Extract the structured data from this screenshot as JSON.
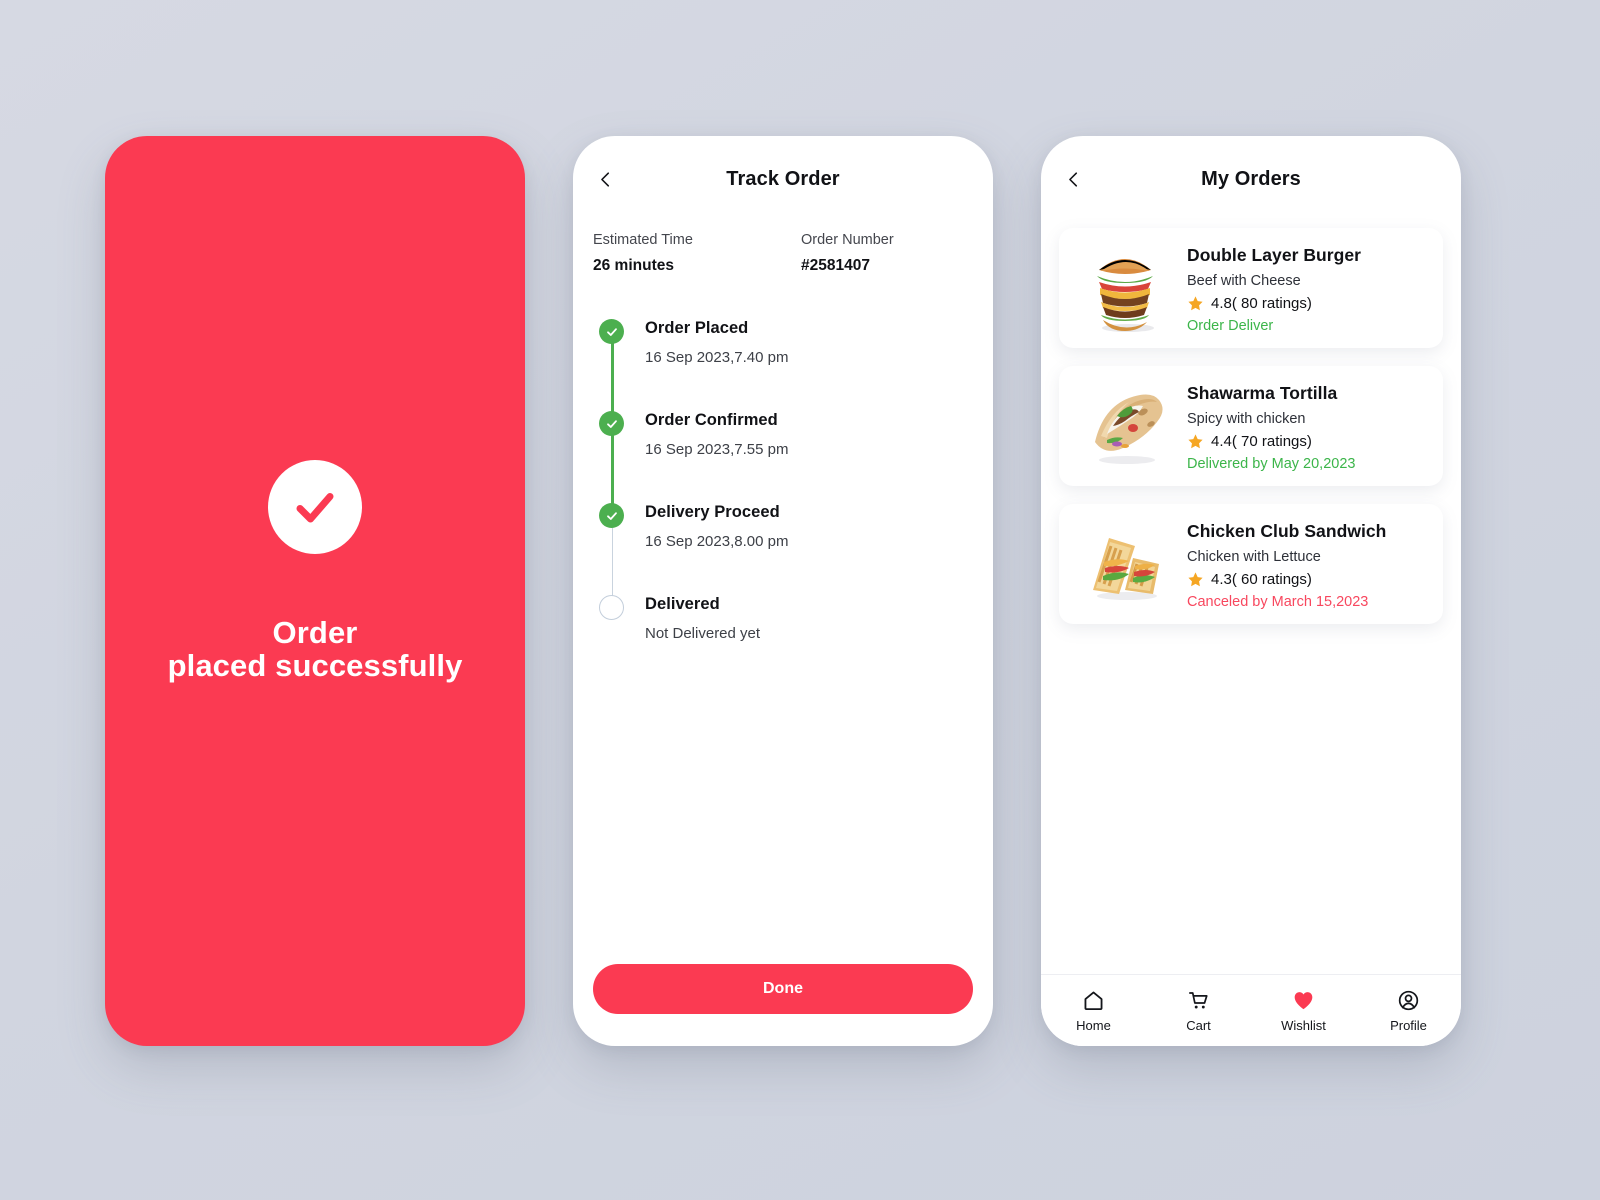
{
  "theme": {
    "brand_red": "#FB3A52",
    "status_green": "#3CB54A",
    "node_green": "#4CAF4F",
    "star_orange": "#F5A623",
    "page_background": "#D3D7E1"
  },
  "success_screen": {
    "icon": "check-circle-icon",
    "title_line1": "Order",
    "title_line2": "placed successfully"
  },
  "track_screen": {
    "back_icon": "chevron-left-icon",
    "title": "Track Order",
    "meta": {
      "estimated_time_label": "Estimated Time",
      "estimated_time_value": "26 minutes",
      "order_number_label": "Order Number",
      "order_number_value": "#2581407"
    },
    "steps": [
      {
        "title": "Order Placed",
        "time": "16 Sep 2023,7.40 pm",
        "state": "done"
      },
      {
        "title": "Order Confirmed",
        "time": "16 Sep 2023,7.55 pm",
        "state": "done"
      },
      {
        "title": "Delivery Proceed",
        "time": "16 Sep 2023,8.00 pm",
        "state": "done"
      },
      {
        "title": "Delivered",
        "time": "Not Delivered yet",
        "state": "pending"
      }
    ],
    "done_button": "Done"
  },
  "orders_screen": {
    "back_icon": "chevron-left-icon",
    "title": "My Orders",
    "orders": [
      {
        "image": "burger-image",
        "name": "Double Layer Burger",
        "description": "Beef with Cheese",
        "rating": "4.8( 80 ratings)",
        "status": "Order Deliver",
        "status_color": "green"
      },
      {
        "image": "shawarma-image",
        "name": "Shawarma Tortilla",
        "description": "Spicy with chicken",
        "rating": "4.4( 70 ratings)",
        "status": "Delivered by May 20,2023",
        "status_color": "green"
      },
      {
        "image": "sandwich-image",
        "name": "Chicken Club Sandwich",
        "description": "Chicken with Lettuce",
        "rating": "4.3( 60 ratings)",
        "status": "Canceled by March 15,2023",
        "status_color": "red"
      }
    ],
    "tabs": [
      {
        "label": "Home",
        "icon": "home-icon",
        "active": false
      },
      {
        "label": "Cart",
        "icon": "cart-icon",
        "active": false
      },
      {
        "label": "Wishlist",
        "icon": "heart-icon",
        "active": true
      },
      {
        "label": "Profile",
        "icon": "profile-icon",
        "active": false
      }
    ]
  }
}
